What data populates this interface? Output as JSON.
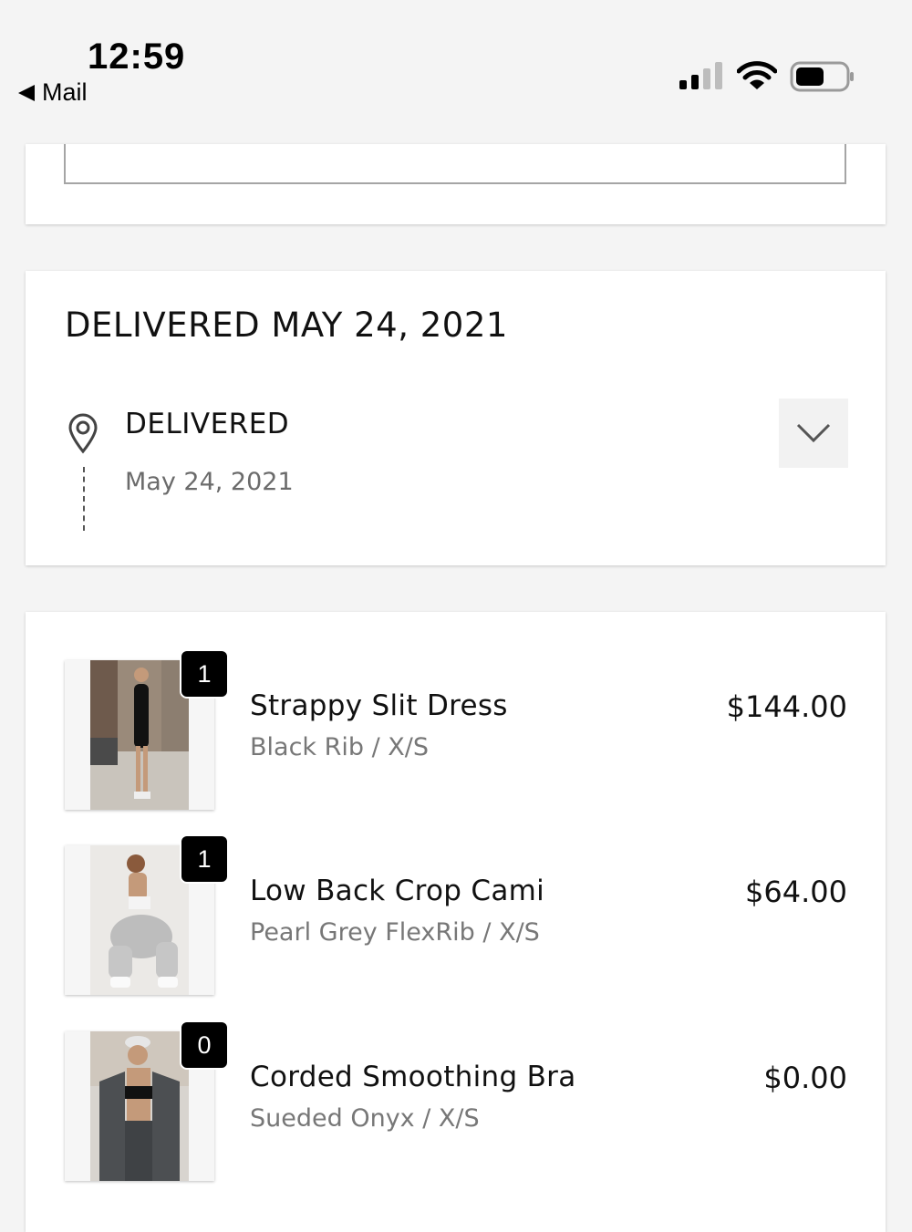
{
  "status_bar": {
    "time": "12:59",
    "back_label": "Mail"
  },
  "delivery": {
    "title": "DELIVERED MAY 24, 2021",
    "status": "DELIVERED",
    "date": "May 24, 2021"
  },
  "items": [
    {
      "name": "Strappy Slit Dress",
      "variant": "Black Rib / X/S",
      "price": "$144.00",
      "qty": "1"
    },
    {
      "name": "Low Back Crop Cami",
      "variant": "Pearl Grey FlexRib / X/S",
      "price": "$64.00",
      "qty": "1"
    },
    {
      "name": "Corded Smoothing Bra",
      "variant": "Sueded Onyx / X/S",
      "price": "$0.00",
      "qty": "0"
    }
  ],
  "colors": {
    "background": "#f4f4f4",
    "card": "#ffffff",
    "text_primary": "#111111",
    "text_secondary": "#777777",
    "badge": "#000000"
  },
  "icons": [
    "back-arrow-icon",
    "cellular-signal-icon",
    "wifi-icon",
    "battery-icon",
    "location-pin-icon",
    "chevron-down-icon"
  ]
}
